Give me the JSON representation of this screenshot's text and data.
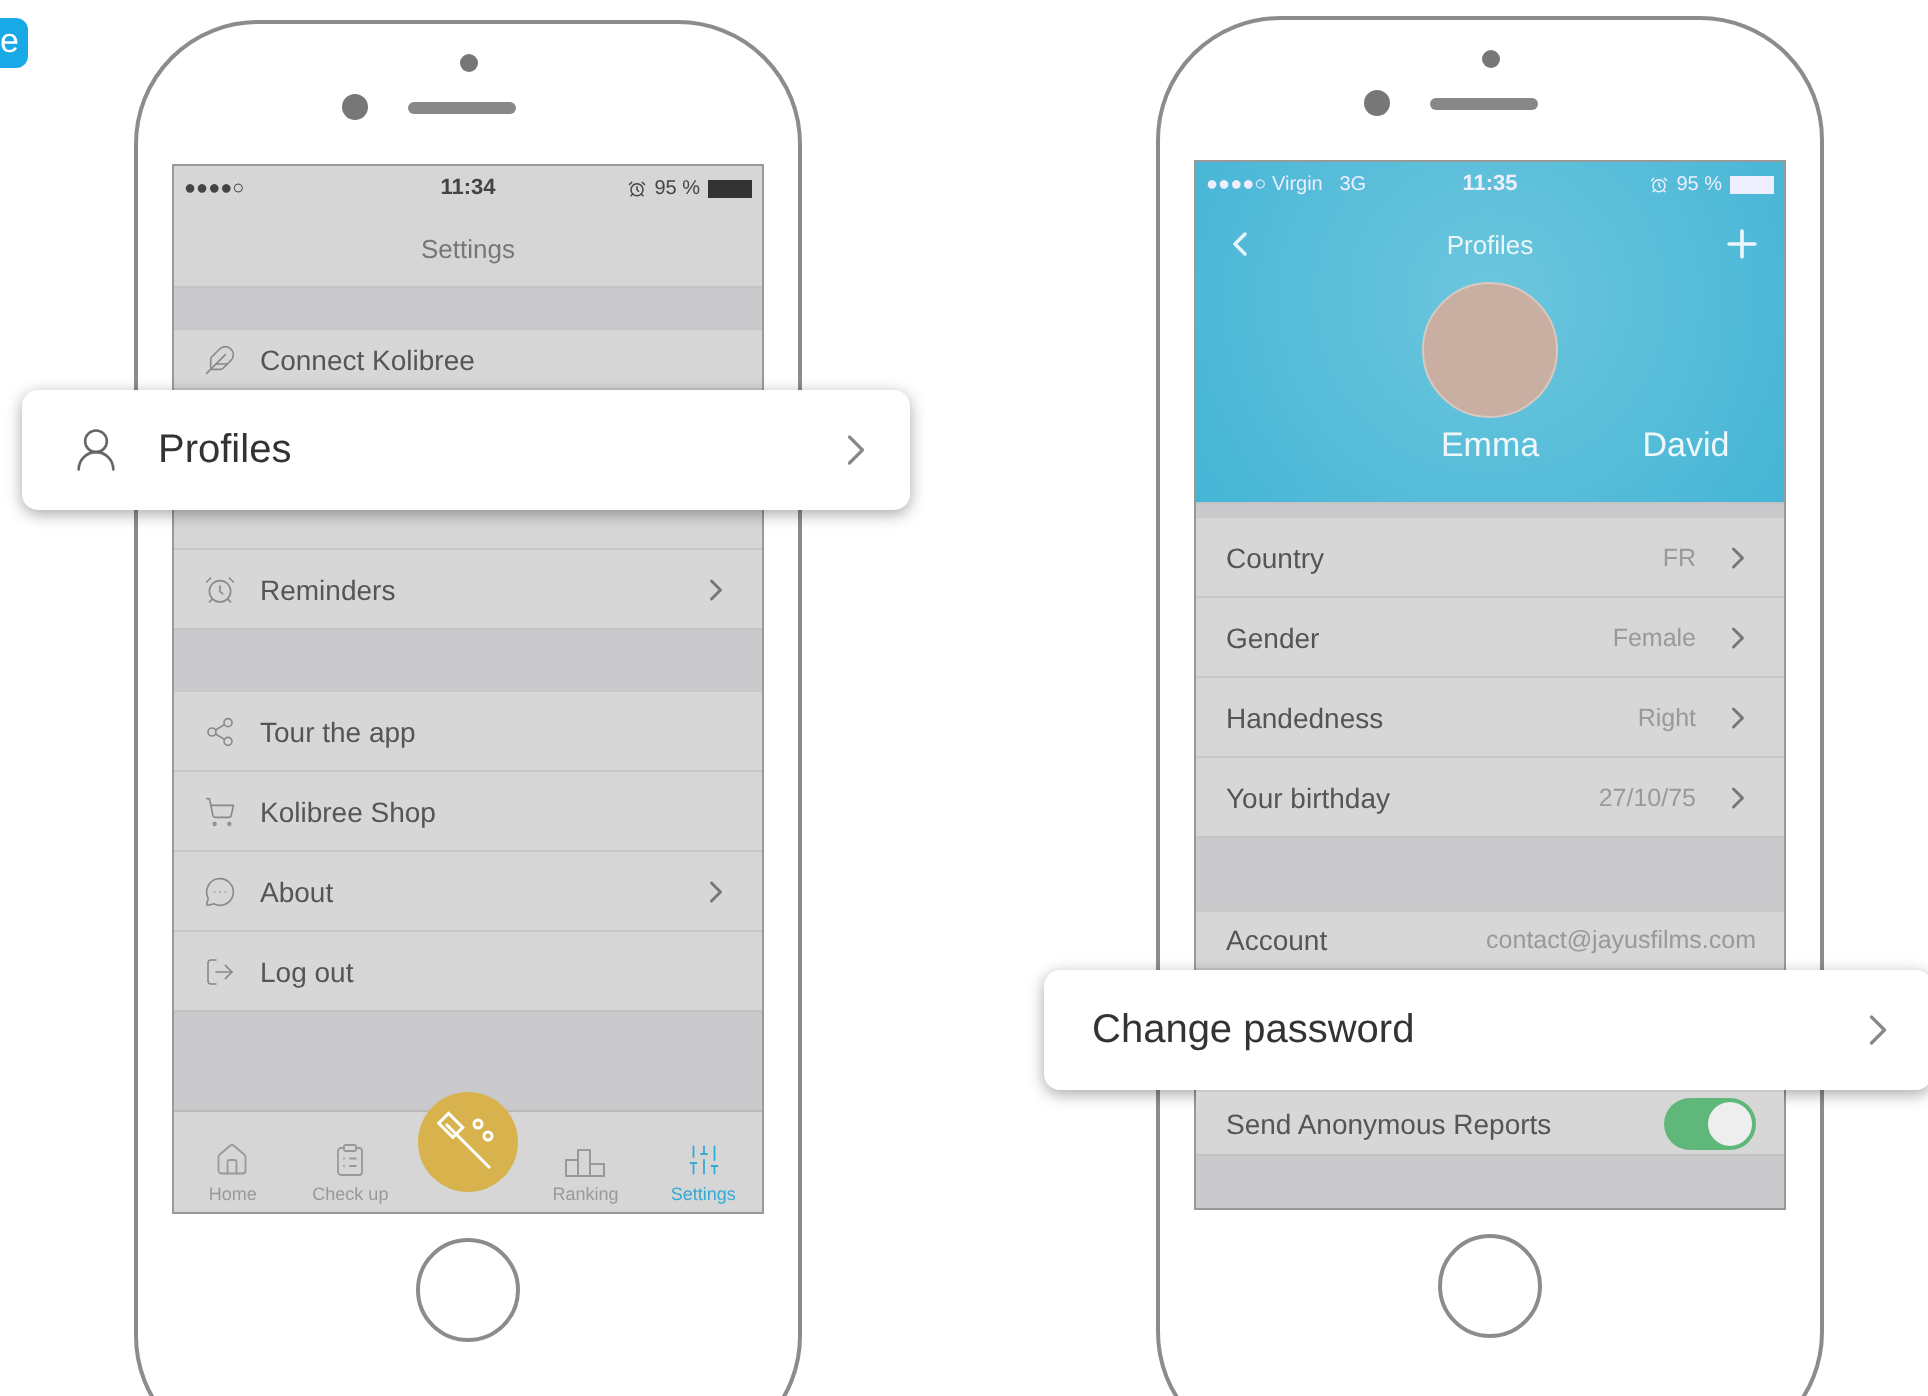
{
  "badge": "e",
  "settings_phone": {
    "status": {
      "carrier": "●●●●○",
      "time": "11:34",
      "battery": "95 %"
    },
    "title": "Settings",
    "groups": [
      [
        {
          "kind": "row",
          "label": "Connect Kolibree",
          "chevron": false
        },
        {
          "kind": "callout",
          "label": "Profiles",
          "chevron": true
        },
        {
          "kind": "row",
          "label": "Reminders",
          "chevron": true
        }
      ],
      [
        {
          "kind": "row",
          "label": "Tour the app",
          "chevron": false
        },
        {
          "kind": "row",
          "label": "Kolibree Shop",
          "chevron": false
        },
        {
          "kind": "row",
          "label": "About",
          "chevron": true
        },
        {
          "kind": "row",
          "label": "Log out",
          "chevron": false
        }
      ]
    ],
    "tabs": [
      {
        "label": "Home",
        "selected": false
      },
      {
        "label": "Check up",
        "selected": false
      },
      {
        "label": "Ranking",
        "selected": false
      },
      {
        "label": "Settings",
        "selected": true
      }
    ]
  },
  "profile_phone": {
    "status": {
      "carrier": "●●●●○ Virgin",
      "network": "3G",
      "time": "11:35",
      "battery": "95 %"
    },
    "title": "Profiles",
    "profiles": [
      {
        "name": "Emma"
      },
      {
        "name": "David"
      }
    ],
    "groups": [
      [
        {
          "kind": "row",
          "label": "Country",
          "value": "FR",
          "chevron": true
        },
        {
          "kind": "row",
          "label": "Gender",
          "value": "Female",
          "chevron": true
        },
        {
          "kind": "row",
          "label": "Handedness",
          "value": "Right",
          "chevron": true
        },
        {
          "kind": "row",
          "label": "Your birthday",
          "value": "27/10/75",
          "chevron": true
        }
      ],
      [
        {
          "kind": "row",
          "label": "Account",
          "value": "contact@jayusfilms.com",
          "chevron": false
        },
        {
          "kind": "callout",
          "label": "Change password",
          "chevron": true
        },
        {
          "kind": "toggle",
          "label": "Send Anonymous Reports",
          "on": true
        }
      ]
    ]
  }
}
